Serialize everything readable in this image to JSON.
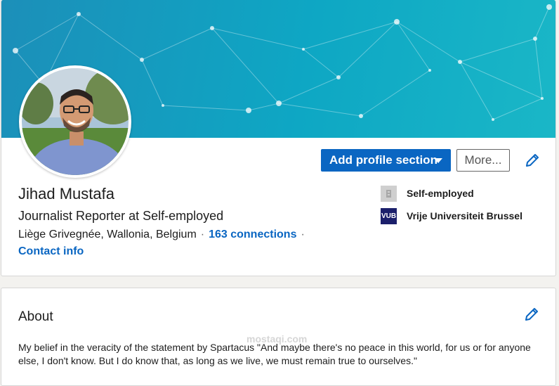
{
  "profile": {
    "name": "Jihad Mustafa",
    "headline": "Journalist Reporter at Self-employed",
    "location": "Liège Grivegnée, Wallonia, Belgium",
    "connections": "163 connections",
    "contact_info": "Contact info",
    "separator": "·"
  },
  "actions": {
    "add_section": "Add profile section",
    "more": "More..."
  },
  "experience": [
    {
      "label": "Self-employed",
      "logo": "company-placeholder-icon"
    },
    {
      "label": "Vrije Universiteit Brussel",
      "logo": "vub-logo",
      "logo_text": "VUB"
    }
  ],
  "about": {
    "title": "About",
    "text": "My belief in the veracity of the statement by Spartacus \"And maybe there's no peace in this world, for us or for anyone else, I don't know. But I do know that, as long as we live, we must remain true to ourselves.\""
  },
  "watermark": "mostaqi.com",
  "colors": {
    "accent": "#0a66c2",
    "banner": "#0ea7c4"
  },
  "icons": {
    "edit": "pencil-icon",
    "dropdown": "caret-down-icon"
  }
}
